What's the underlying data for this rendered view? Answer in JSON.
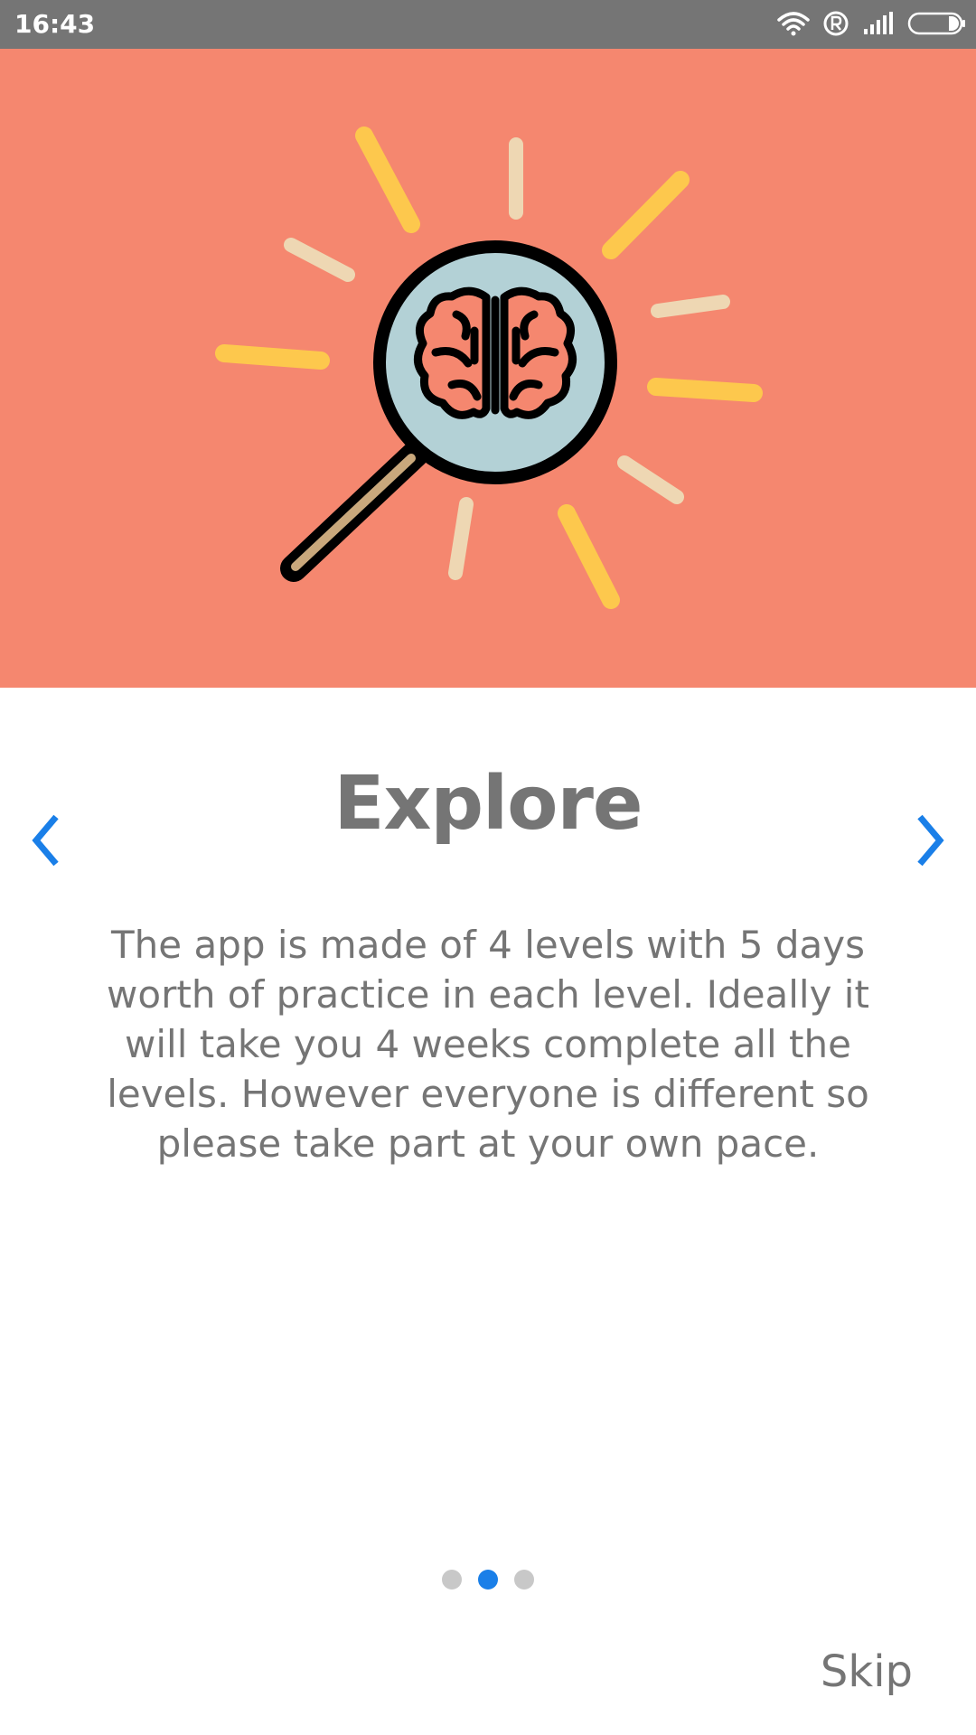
{
  "status_bar": {
    "time": "16:43",
    "icons": [
      "wifi-icon",
      "registered-icon",
      "cellular-signal-icon",
      "battery-icon"
    ]
  },
  "hero": {
    "background": "#f5876f",
    "illustration": "magnifying-glass-brain-icon"
  },
  "slide": {
    "title": "Explore",
    "description": "The app is made of 4 levels with 5 days worth of practice in each level. Ideally it will take you 4 weeks complete all the levels. However everyone is different so please take part at your own pace."
  },
  "navigation": {
    "prev_icon": "chevron-left-icon",
    "next_icon": "chevron-right-icon",
    "accent": "#1a7fe8"
  },
  "pager": {
    "total": 3,
    "active_index": 1
  },
  "skip_label": "Skip"
}
